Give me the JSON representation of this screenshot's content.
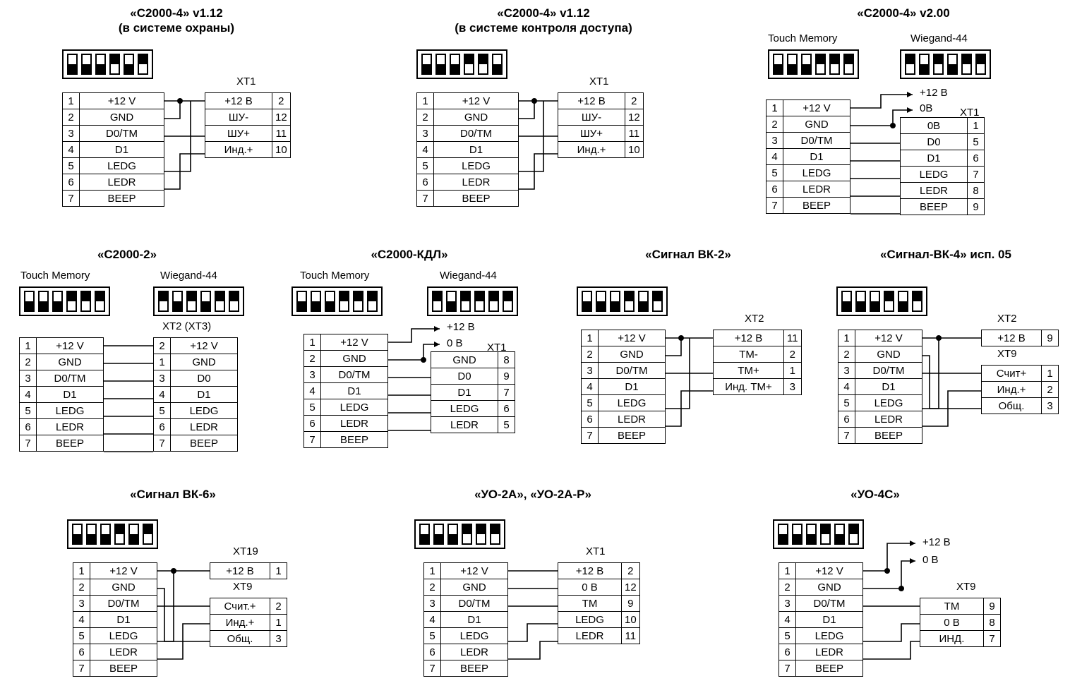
{
  "page": {
    "description": "Reader connection diagrams for Bolid security devices (DIP switch settings and terminal wiring tables)"
  },
  "common": {
    "reader_pins": [
      {
        "num": "1",
        "name": "+12 V"
      },
      {
        "num": "2",
        "name": "GND"
      },
      {
        "num": "3",
        "name": "D0/TM"
      },
      {
        "num": "4",
        "name": "D1"
      },
      {
        "num": "5",
        "name": "LEDG"
      },
      {
        "num": "6",
        "name": "LEDR"
      },
      {
        "num": "7",
        "name": "BEEP"
      }
    ],
    "dip_touch_memory_label": "Touch Memory",
    "dip_wiegand_label": "Wiegand-44"
  },
  "diagrams": [
    {
      "id": "c2000-4-v112-security",
      "title": "«С2000-4» v1.12",
      "subtitle": "(в системе охраны)",
      "dips": [
        {
          "label": "",
          "switches": [
            "down",
            "down",
            "down",
            "up",
            "down",
            "up"
          ]
        }
      ],
      "left_table": {
        "pins": [
          {
            "num": "1",
            "name": "+12 V"
          },
          {
            "num": "2",
            "name": "GND"
          },
          {
            "num": "3",
            "name": "D0/TM"
          },
          {
            "num": "4",
            "name": "D1"
          },
          {
            "num": "5",
            "name": "LEDG"
          },
          {
            "num": "6",
            "name": "LEDR"
          },
          {
            "num": "7",
            "name": "BEEP"
          }
        ]
      },
      "right_tables": [
        {
          "header": "XT1",
          "rows": [
            {
              "name": "+12 В",
              "num": "2"
            },
            {
              "name": "ШУ-",
              "num": "12"
            },
            {
              "name": "ШУ+",
              "num": "11"
            },
            {
              "name": "Инд.+",
              "num": "10"
            }
          ]
        }
      ]
    },
    {
      "id": "c2000-4-v112-access",
      "title": "«С2000-4» v1.12",
      "subtitle": "(в системе контроля доступа)",
      "dips": [
        {
          "label": "",
          "switches": [
            "down",
            "down",
            "down",
            "up",
            "up",
            "down"
          ]
        }
      ],
      "left_table": {
        "pins": [
          {
            "num": "1",
            "name": "+12 V"
          },
          {
            "num": "2",
            "name": "GND"
          },
          {
            "num": "3",
            "name": "D0/TM"
          },
          {
            "num": "4",
            "name": "D1"
          },
          {
            "num": "5",
            "name": "LEDG"
          },
          {
            "num": "6",
            "name": "LEDR"
          },
          {
            "num": "7",
            "name": "BEEP"
          }
        ]
      },
      "right_tables": [
        {
          "header": "XT1",
          "rows": [
            {
              "name": "+12 В",
              "num": "2"
            },
            {
              "name": "ШУ-",
              "num": "12"
            },
            {
              "name": "ШУ+",
              "num": "11"
            },
            {
              "name": "Инд.+",
              "num": "10"
            }
          ]
        }
      ]
    },
    {
      "id": "c2000-4-v200",
      "title": "«С2000-4» v2.00",
      "subtitle": "",
      "dips": [
        {
          "label": "Touch Memory",
          "switches": [
            "down",
            "down",
            "down",
            "up",
            "up",
            "up"
          ]
        },
        {
          "label": "Wiegand-44",
          "switches": [
            "up",
            "down",
            "up",
            "down",
            "up",
            "up"
          ]
        }
      ],
      "arrows": [
        {
          "label": "+12 В"
        },
        {
          "label": "0В"
        }
      ],
      "left_table": {
        "pins": [
          {
            "num": "1",
            "name": "+12 V"
          },
          {
            "num": "2",
            "name": "GND"
          },
          {
            "num": "3",
            "name": "D0/TM"
          },
          {
            "num": "4",
            "name": "D1"
          },
          {
            "num": "5",
            "name": "LEDG"
          },
          {
            "num": "6",
            "name": "LEDR"
          },
          {
            "num": "7",
            "name": "BEEP"
          }
        ]
      },
      "right_tables": [
        {
          "header": "XT1",
          "rows": [
            {
              "name": "0В",
              "num": "1"
            },
            {
              "name": "D0",
              "num": "5"
            },
            {
              "name": "D1",
              "num": "6"
            },
            {
              "name": "LEDG",
              "num": "7"
            },
            {
              "name": "LEDR",
              "num": "8"
            },
            {
              "name": "BEEP",
              "num": "9"
            }
          ]
        }
      ]
    },
    {
      "id": "c2000-2",
      "title": "«С2000-2»",
      "subtitle": "",
      "dips": [
        {
          "label": "Touch Memory",
          "switches": [
            "down",
            "down",
            "down",
            "up",
            "up",
            "up"
          ]
        },
        {
          "label": "Wiegand-44",
          "switches": [
            "up",
            "down",
            "up",
            "down",
            "up",
            "up"
          ]
        }
      ],
      "left_table": {
        "pins": [
          {
            "num": "1",
            "name": "+12 V"
          },
          {
            "num": "2",
            "name": "GND"
          },
          {
            "num": "3",
            "name": "D0/TM"
          },
          {
            "num": "4",
            "name": "D1"
          },
          {
            "num": "5",
            "name": "LEDG"
          },
          {
            "num": "6",
            "name": "LEDR"
          },
          {
            "num": "7",
            "name": "BEEP"
          }
        ]
      },
      "right_tables": [
        {
          "header": "XT2 (XT3)",
          "num_first": true,
          "rows": [
            {
              "num": "2",
              "name": "+12 V"
            },
            {
              "num": "1",
              "name": "GND"
            },
            {
              "num": "3",
              "name": "D0"
            },
            {
              "num": "4",
              "name": "D1"
            },
            {
              "num": "5",
              "name": "LEDG"
            },
            {
              "num": "6",
              "name": "LEDR"
            },
            {
              "num": "7",
              "name": "BEEP"
            }
          ]
        }
      ]
    },
    {
      "id": "c2000-kdl",
      "title": "«С2000-КДЛ»",
      "subtitle": "",
      "dips": [
        {
          "label": "Touch Memory",
          "switches": [
            "down",
            "down",
            "down",
            "up",
            "up",
            "up"
          ]
        },
        {
          "label": "Wiegand-44",
          "switches": [
            "up",
            "down",
            "up",
            "up",
            "up",
            "up"
          ]
        }
      ],
      "arrows": [
        {
          "label": "+12 В"
        },
        {
          "label": "0 В"
        }
      ],
      "left_table": {
        "pins": [
          {
            "num": "1",
            "name": "+12 V"
          },
          {
            "num": "2",
            "name": "GND"
          },
          {
            "num": "3",
            "name": "D0/TM"
          },
          {
            "num": "4",
            "name": "D1"
          },
          {
            "num": "5",
            "name": "LEDG"
          },
          {
            "num": "6",
            "name": "LEDR"
          },
          {
            "num": "7",
            "name": "BEEP"
          }
        ]
      },
      "right_tables": [
        {
          "header": "XT1",
          "rows": [
            {
              "name": "GND",
              "num": "8"
            },
            {
              "name": "D0",
              "num": "9"
            },
            {
              "name": "D1",
              "num": "7"
            },
            {
              "name": "LEDG",
              "num": "6"
            },
            {
              "name": "LEDR",
              "num": "5"
            }
          ]
        }
      ]
    },
    {
      "id": "signal-vk-2",
      "title": "«Сигнал ВК-2»",
      "subtitle": "",
      "dips": [
        {
          "label": "",
          "switches": [
            "down",
            "down",
            "down",
            "up",
            "down",
            "up"
          ]
        }
      ],
      "left_table": {
        "pins": [
          {
            "num": "1",
            "name": "+12 V"
          },
          {
            "num": "2",
            "name": "GND"
          },
          {
            "num": "3",
            "name": "D0/TM"
          },
          {
            "num": "4",
            "name": "D1"
          },
          {
            "num": "5",
            "name": "LEDG"
          },
          {
            "num": "6",
            "name": "LEDR"
          },
          {
            "num": "7",
            "name": "BEEP"
          }
        ]
      },
      "right_tables": [
        {
          "header": "XT2",
          "rows": [
            {
              "name": "+12 В",
              "num": "11"
            },
            {
              "name": "ТМ-",
              "num": "2"
            },
            {
              "name": "ТМ+",
              "num": "1"
            },
            {
              "name": "Инд. ТМ+",
              "num": "3"
            }
          ]
        }
      ]
    },
    {
      "id": "signal-vk-4-isp05",
      "title": "«Сигнал-ВК-4» исп. 05",
      "subtitle": "",
      "dips": [
        {
          "label": "",
          "switches": [
            "down",
            "down",
            "down",
            "up",
            "down",
            "up"
          ]
        }
      ],
      "left_table": {
        "pins": [
          {
            "num": "1",
            "name": "+12 V"
          },
          {
            "num": "2",
            "name": "GND"
          },
          {
            "num": "3",
            "name": "D0/TM"
          },
          {
            "num": "4",
            "name": "D1"
          },
          {
            "num": "5",
            "name": "LEDG"
          },
          {
            "num": "6",
            "name": "LEDR"
          },
          {
            "num": "7",
            "name": "BEEP"
          }
        ]
      },
      "right_tables": [
        {
          "header": "XT2",
          "rows": [
            {
              "name": "+12 В",
              "num": "9"
            }
          ]
        },
        {
          "header": "XT9",
          "rows": [
            {
              "name": "Счит+",
              "num": "1"
            },
            {
              "name": "Инд.+",
              "num": "2"
            },
            {
              "name": "Общ.",
              "num": "3"
            }
          ]
        }
      ]
    },
    {
      "id": "signal-vk-6",
      "title": "«Сигнал ВК-6»",
      "subtitle": "",
      "dips": [
        {
          "label": "",
          "switches": [
            "down",
            "down",
            "down",
            "up",
            "down",
            "up"
          ]
        }
      ],
      "left_table": {
        "pins": [
          {
            "num": "1",
            "name": "+12 V"
          },
          {
            "num": "2",
            "name": "GND"
          },
          {
            "num": "3",
            "name": "D0/TM"
          },
          {
            "num": "4",
            "name": "D1"
          },
          {
            "num": "5",
            "name": "LEDG"
          },
          {
            "num": "6",
            "name": "LEDR"
          },
          {
            "num": "7",
            "name": "BEEP"
          }
        ]
      },
      "right_tables": [
        {
          "header": "XT19",
          "rows": [
            {
              "name": "+12 В",
              "num": "1"
            }
          ]
        },
        {
          "header": "XT9",
          "rows": [
            {
              "name": "Счит.+",
              "num": "2"
            },
            {
              "name": "Инд.+",
              "num": "1"
            },
            {
              "name": "Общ.",
              "num": "3"
            }
          ]
        }
      ]
    },
    {
      "id": "uo-2a",
      "title": "«УО-2А», «УО-2А-Р»",
      "subtitle": "",
      "dips": [
        {
          "label": "",
          "switches": [
            "down",
            "down",
            "down",
            "up",
            "up",
            "up"
          ]
        }
      ],
      "left_table": {
        "pins": [
          {
            "num": "1",
            "name": "+12 V"
          },
          {
            "num": "2",
            "name": "GND"
          },
          {
            "num": "3",
            "name": "D0/TM"
          },
          {
            "num": "4",
            "name": "D1"
          },
          {
            "num": "5",
            "name": "LEDG"
          },
          {
            "num": "6",
            "name": "LEDR"
          },
          {
            "num": "7",
            "name": "BEEP"
          }
        ]
      },
      "right_tables": [
        {
          "header": "XT1",
          "rows": [
            {
              "name": "+12 В",
              "num": "2"
            },
            {
              "name": "0 В",
              "num": "12"
            },
            {
              "name": "ТМ",
              "num": "9"
            },
            {
              "name": "LEDG",
              "num": "10"
            },
            {
              "name": "LEDR",
              "num": "11"
            }
          ]
        }
      ]
    },
    {
      "id": "uo-4c",
      "title": "«УО-4С»",
      "subtitle": "",
      "dips": [
        {
          "label": "",
          "switches": [
            "down",
            "down",
            "down",
            "up",
            "down",
            "up"
          ]
        }
      ],
      "arrows": [
        {
          "label": "+12 В"
        },
        {
          "label": "0 В"
        }
      ],
      "left_table": {
        "pins": [
          {
            "num": "1",
            "name": "+12 V"
          },
          {
            "num": "2",
            "name": "GND"
          },
          {
            "num": "3",
            "name": "D0/TM"
          },
          {
            "num": "4",
            "name": "D1"
          },
          {
            "num": "5",
            "name": "LEDG"
          },
          {
            "num": "6",
            "name": "LEDR"
          },
          {
            "num": "7",
            "name": "BEEP"
          }
        ]
      },
      "right_tables": [
        {
          "header": "XT9",
          "rows": [
            {
              "name": "ТМ",
              "num": "9"
            },
            {
              "name": "0 В",
              "num": "8"
            },
            {
              "name": "ИНД.",
              "num": "7"
            }
          ]
        }
      ]
    }
  ]
}
